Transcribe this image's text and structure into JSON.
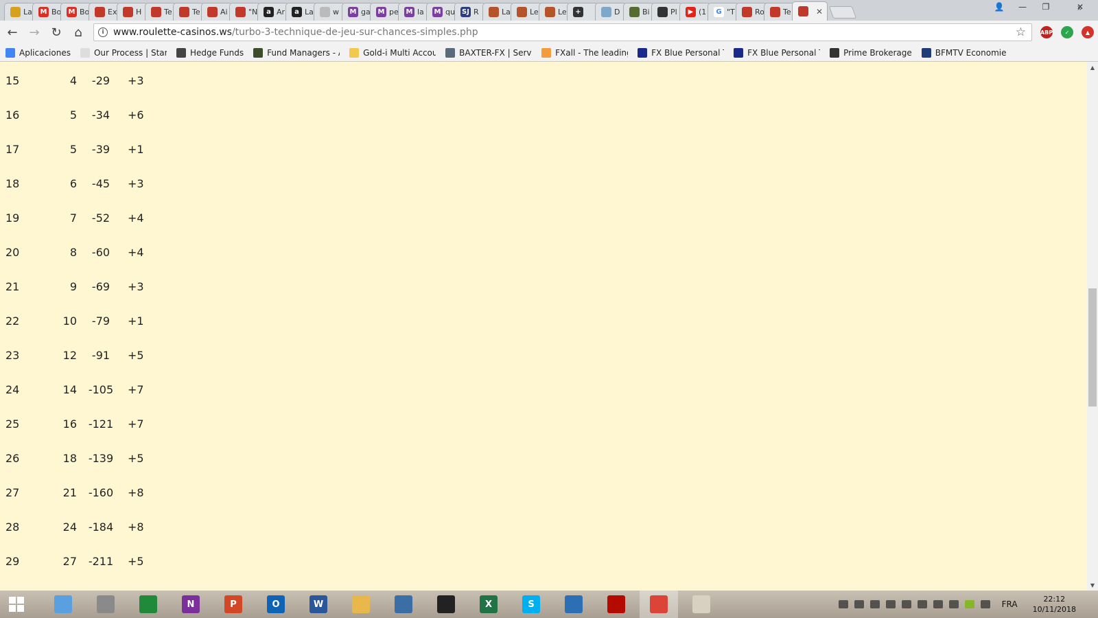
{
  "browser": {
    "tabs": [
      {
        "title": "La",
        "color": "#d6a21e",
        "glyph": ""
      },
      {
        "title": "Bo",
        "color": "#d93025",
        "glyph": "M"
      },
      {
        "title": "Bo",
        "color": "#d93025",
        "glyph": "M"
      },
      {
        "title": "Ex",
        "color": "#c0392b",
        "glyph": ""
      },
      {
        "title": "H",
        "color": "#c0392b",
        "glyph": ""
      },
      {
        "title": "Te",
        "color": "#c0392b",
        "glyph": ""
      },
      {
        "title": "Te",
        "color": "#c0392b",
        "glyph": ""
      },
      {
        "title": "Ai",
        "color": "#c0392b",
        "glyph": ""
      },
      {
        "title": "\"N",
        "color": "#c0392b",
        "glyph": ""
      },
      {
        "title": "Ar",
        "color": "#222222",
        "glyph": "a"
      },
      {
        "title": "La",
        "color": "#222222",
        "glyph": "a"
      },
      {
        "title": "w",
        "color": "#bbbbbb",
        "glyph": ""
      },
      {
        "title": "ga",
        "color": "#7b3fa0",
        "glyph": "M"
      },
      {
        "title": "pe",
        "color": "#7b3fa0",
        "glyph": "M"
      },
      {
        "title": "la",
        "color": "#7b3fa0",
        "glyph": "M"
      },
      {
        "title": "qu",
        "color": "#7b3fa0",
        "glyph": "M"
      },
      {
        "title": "R",
        "color": "#2c3e80",
        "glyph": "SJ"
      },
      {
        "title": "La",
        "color": "#b5532a",
        "glyph": ""
      },
      {
        "title": "Le",
        "color": "#b5532a",
        "glyph": ""
      },
      {
        "title": "Le",
        "color": "#b5532a",
        "glyph": ""
      },
      {
        "title": "",
        "color": "#333333",
        "glyph": "+"
      },
      {
        "title": "D",
        "color": "#7fa8c8",
        "glyph": ""
      },
      {
        "title": "Bi",
        "color": "#556b2f",
        "glyph": ""
      },
      {
        "title": "Pl",
        "color": "#333333",
        "glyph": ""
      },
      {
        "title": "(1",
        "color": "#e62117",
        "glyph": "▶"
      },
      {
        "title": "\"T",
        "color": "#ffffff",
        "glyph": "G"
      },
      {
        "title": "Ro",
        "color": "#c0392b",
        "glyph": ""
      },
      {
        "title": "Te",
        "color": "#c0392b",
        "glyph": ""
      },
      {
        "title": "",
        "color": "#c0392b",
        "glyph": "",
        "active": true
      }
    ],
    "active_tab_close": "✕",
    "window_controls": {
      "user": "👤",
      "minimize": "—",
      "restore": "❐",
      "close": "✕"
    },
    "nav": {
      "back": "←",
      "forward": "→",
      "reload": "↻",
      "home": "⌂"
    },
    "url": {
      "info_icon": "i",
      "host": "www.roulette-casinos.ws",
      "path": "/turbo-3-technique-de-jeu-sur-chances-simples.php",
      "star_icon": "☆"
    },
    "extensions": [
      {
        "name": "adblock-plus-icon",
        "color": "#c0221f",
        "label": "ABP"
      },
      {
        "name": "check-extension-icon",
        "color": "#2ea44f",
        "label": "✓"
      },
      {
        "name": "red-extension-icon",
        "color": "#d4322c",
        "label": "▲"
      }
    ],
    "bookmarks": [
      {
        "label": "Aplicaciones",
        "color": "#4285f4"
      },
      {
        "label": "Our Process | Start a",
        "color": "#dddddd"
      },
      {
        "label": "Hedge Funds",
        "color": "#444444"
      },
      {
        "label": "Fund Managers - Adv",
        "color": "#3d4d2a"
      },
      {
        "label": "Gold-i Multi Account",
        "color": "#f2c94c"
      },
      {
        "label": "BAXTER-FX | Services",
        "color": "#5b6b7c"
      },
      {
        "label": "FXall - The leading in",
        "color": "#f39c3d"
      },
      {
        "label": "FX Blue Personal Trac",
        "color": "#1a2a8a"
      },
      {
        "label": "FX Blue Personal Trac",
        "color": "#1a2a8a"
      },
      {
        "label": "Prime Brokerage",
        "color": "#333333"
      },
      {
        "label": "BFMTV Economie – la",
        "color": "#1e3c78"
      }
    ],
    "bookmarks_more": "»"
  },
  "page": {
    "rows": [
      {
        "n": "15",
        "bet": "4",
        "total": "-29",
        "gain": "+3"
      },
      {
        "n": "16",
        "bet": "5",
        "total": "-34",
        "gain": "+6"
      },
      {
        "n": "17",
        "bet": "5",
        "total": "-39",
        "gain": "+1"
      },
      {
        "n": "18",
        "bet": "6",
        "total": "-45",
        "gain": "+3"
      },
      {
        "n": "19",
        "bet": "7",
        "total": "-52",
        "gain": "+4"
      },
      {
        "n": "20",
        "bet": "8",
        "total": "-60",
        "gain": "+4"
      },
      {
        "n": "21",
        "bet": "9",
        "total": "-69",
        "gain": "+3"
      },
      {
        "n": "22",
        "bet": "10",
        "total": "-79",
        "gain": "+1"
      },
      {
        "n": "23",
        "bet": "12",
        "total": "-91",
        "gain": "+5"
      },
      {
        "n": "24",
        "bet": "14",
        "total": "-105",
        "gain": "+7"
      },
      {
        "n": "25",
        "bet": "16",
        "total": "-121",
        "gain": "+7"
      },
      {
        "n": "26",
        "bet": "18",
        "total": "-139",
        "gain": "+5"
      },
      {
        "n": "27",
        "bet": "21",
        "total": "-160",
        "gain": "+8"
      },
      {
        "n": "28",
        "bet": "24",
        "total": "-184",
        "gain": "+8"
      },
      {
        "n": "29",
        "bet": "27",
        "total": "-211",
        "gain": "+5"
      }
    ],
    "background": "#fff7d2"
  },
  "taskbar": {
    "apps": [
      {
        "name": "ie-like-app",
        "color": "#5aa0e0",
        "label": ""
      },
      {
        "name": "notepad-app",
        "color": "#8a8a8a",
        "label": ""
      },
      {
        "name": "sheets-app",
        "color": "#1f8b3a",
        "label": ""
      },
      {
        "name": "onenote-app",
        "color": "#7b2f9a",
        "label": "N"
      },
      {
        "name": "powerpoint-app",
        "color": "#d24726",
        "label": "P"
      },
      {
        "name": "outlook-app",
        "color": "#0f63b5",
        "label": "O"
      },
      {
        "name": "word-app",
        "color": "#2b579a",
        "label": "W"
      },
      {
        "name": "explorer-app",
        "color": "#e8b84a",
        "label": ""
      },
      {
        "name": "owl-app",
        "color": "#3a6ea5",
        "label": ""
      },
      {
        "name": "mask-app",
        "color": "#222222",
        "label": ""
      },
      {
        "name": "excel-app",
        "color": "#217346",
        "label": "X"
      },
      {
        "name": "skype-app",
        "color": "#00aff0",
        "label": "S"
      },
      {
        "name": "network-app",
        "color": "#2d6fb5",
        "label": ""
      },
      {
        "name": "acrobat-app",
        "color": "#b30b00",
        "label": ""
      },
      {
        "name": "chrome-app",
        "color": "#db4437",
        "label": "",
        "active": true
      },
      {
        "name": "paint-app",
        "color": "#d8d0c0",
        "label": ""
      }
    ],
    "language": "FRA",
    "time": "22:12",
    "date": "10/11/2018"
  }
}
